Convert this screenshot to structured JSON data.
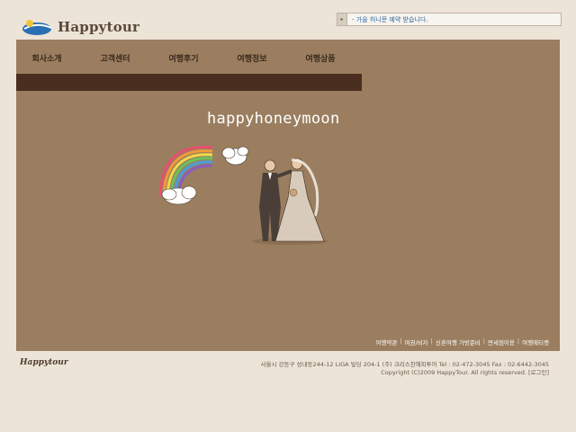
{
  "brand": {
    "name": "Happytour"
  },
  "notice": {
    "text": "- 가을 허니문 예약 받습니다."
  },
  "nav": {
    "items": [
      "회사소개",
      "고객센터",
      "여행후기",
      "여행정보",
      "여행상품"
    ]
  },
  "hero": {
    "headline": "happyhoneymoon"
  },
  "footer": {
    "links": [
      "여행약관",
      "여권/비자",
      "신혼여행 가방준비",
      "면세점이용",
      "여행에티켓"
    ],
    "logo": "Happytour",
    "address": "서울시 강동구 성내동244-12 LIGA 빌딩 204-1 (주) 크리스찬해피투어 Tel : 02-472-3045 Fax : 02-6442-3045",
    "copyright": "Copyright (C)2009 HappyTour. All rights reserved. [로그인]"
  },
  "colors": {
    "page_bg": "#ede4d8",
    "main_bg": "#9a7e5f",
    "nav_bar": "#4a2f20"
  }
}
